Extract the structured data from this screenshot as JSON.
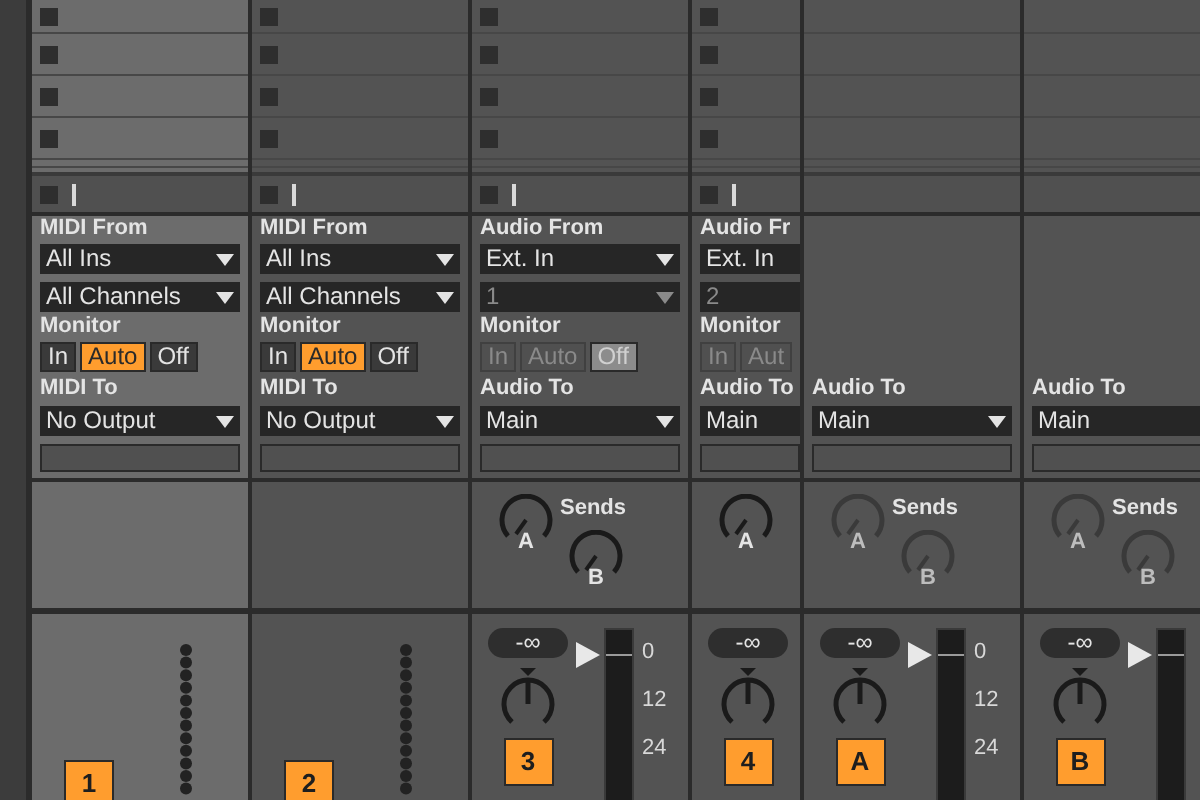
{
  "tracks": [
    {
      "kind": "midi",
      "selected": true,
      "narrow": false,
      "input_label": "MIDI From",
      "input": "All Ins",
      "channel": "All Channels",
      "monitor_label": "Monitor",
      "monitor": [
        {
          "label": "In",
          "selected": false
        },
        {
          "label": "Auto",
          "selected": true
        },
        {
          "label": "Off",
          "selected": false
        }
      ],
      "monitor_disabled": false,
      "output_label": "MIDI To",
      "output": "No Output",
      "number": "1"
    },
    {
      "kind": "midi",
      "selected": false,
      "narrow": false,
      "input_label": "MIDI From",
      "input": "All Ins",
      "channel": "All Channels",
      "monitor_label": "Monitor",
      "monitor": [
        {
          "label": "In",
          "selected": false
        },
        {
          "label": "Auto",
          "selected": true
        },
        {
          "label": "Off",
          "selected": false
        }
      ],
      "monitor_disabled": false,
      "output_label": "MIDI To",
      "output": "No Output",
      "number": "2"
    },
    {
      "kind": "audio",
      "selected": false,
      "narrow": false,
      "input_label": "Audio From",
      "input": "Ext. In",
      "channel": "1",
      "monitor_label": "Monitor",
      "monitor": [
        {
          "label": "In",
          "selected": false
        },
        {
          "label": "Auto",
          "selected": false
        },
        {
          "label": "Off",
          "selected": true
        }
      ],
      "monitor_disabled": true,
      "output_label": "Audio To",
      "output": "Main",
      "sends_label": "Sends",
      "sends": [
        {
          "label": "A",
          "disabled": false
        },
        {
          "label": "B",
          "disabled": false
        }
      ],
      "volume": "-∞",
      "meter": true,
      "meter_ticks": [
        "0",
        "12",
        "24"
      ],
      "number": "3"
    },
    {
      "kind": "audio",
      "selected": false,
      "narrow": true,
      "input_label": "Audio Fr",
      "input": "Ext. In",
      "channel": "2",
      "monitor_label": "Monitor",
      "monitor": [
        {
          "label": "In",
          "selected": false
        },
        {
          "label": "Aut",
          "selected": false
        }
      ],
      "monitor_disabled": true,
      "output_label": "Audio To",
      "output": "Main",
      "sends": [
        {
          "label": "A",
          "disabled": false
        }
      ],
      "volume": "-∞",
      "meter": false,
      "number": "4"
    },
    {
      "kind": "return",
      "selected": false,
      "narrow": false,
      "output_label": "Audio To",
      "output": "Main",
      "sends_label": "Sends",
      "sends": [
        {
          "label": "A",
          "disabled": true
        },
        {
          "label": "B",
          "disabled": true
        }
      ],
      "volume": "-∞",
      "meter": true,
      "meter_ticks": [
        "0",
        "12",
        "24"
      ],
      "number": "A"
    },
    {
      "kind": "return",
      "selected": false,
      "narrow": true,
      "output_label": "Audio To",
      "output": "Main",
      "sends_label": "Sends",
      "sends": [
        {
          "label": "A",
          "disabled": true
        },
        {
          "label": "B",
          "disabled": true
        }
      ],
      "volume": "-∞",
      "meter": true,
      "number": "B"
    }
  ]
}
